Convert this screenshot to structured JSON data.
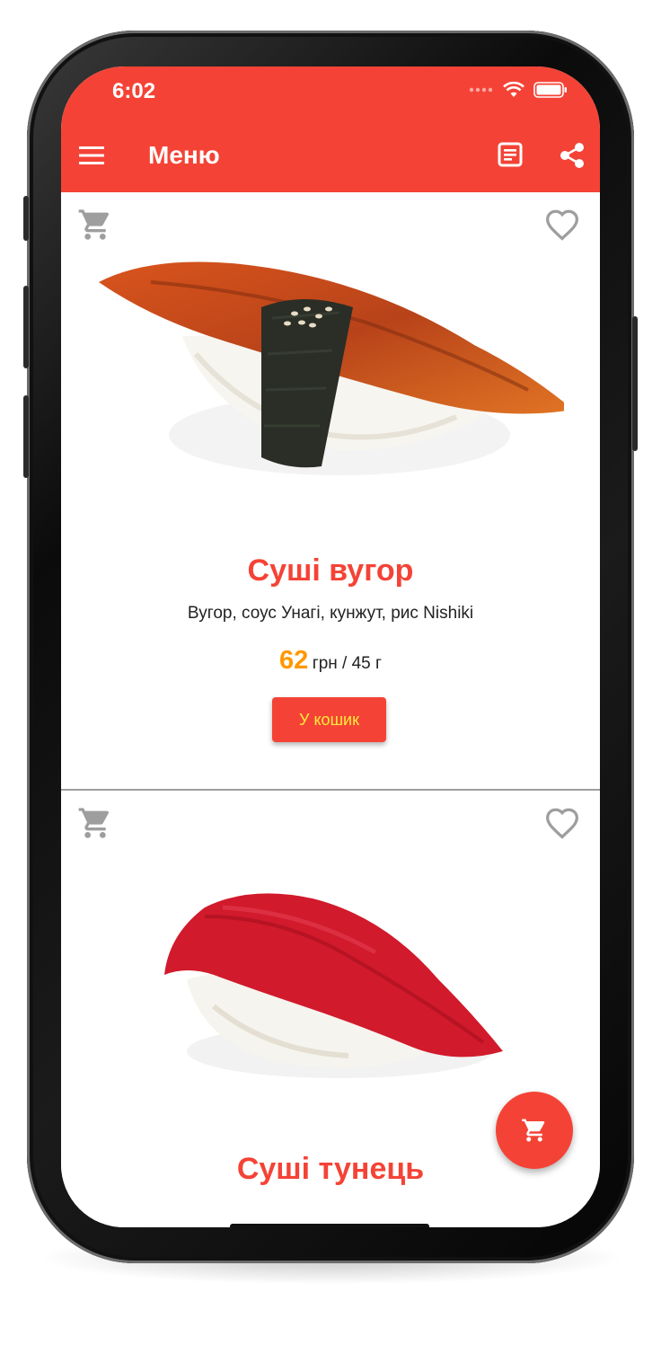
{
  "status_bar": {
    "time": "6:02"
  },
  "toolbar": {
    "title": "Меню",
    "icons": [
      "menu-icon",
      "receipt-icon",
      "share-icon"
    ]
  },
  "products": [
    {
      "name": "Суші вугор",
      "description": "Вугор, соус Унагі, кунжут, рис Nishiki",
      "price": "62",
      "unit": "грн / 45 г",
      "button_label": "У кошик"
    },
    {
      "name": "Суші тунець"
    }
  ],
  "colors": {
    "primary": "#f44336",
    "price": "#ff9800",
    "button_text": "#ffeb3b",
    "icon_grey": "#9e9e9e"
  }
}
